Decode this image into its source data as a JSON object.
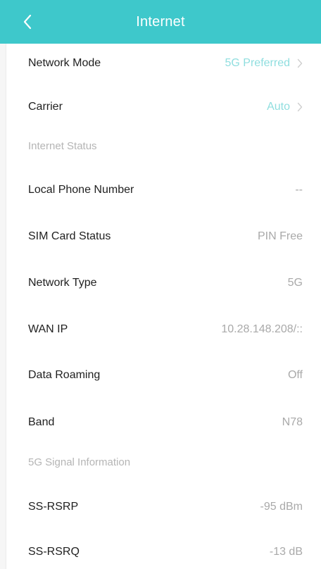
{
  "header": {
    "title": "Internet",
    "back_icon": "chevron-left-icon"
  },
  "settings": [
    {
      "label": "Network Mode",
      "value": "5G Preferred"
    },
    {
      "label": "Carrier",
      "value": "Auto"
    }
  ],
  "sections": {
    "internet_status": "Internet Status",
    "signal_info": "5G Signal Information"
  },
  "status": [
    {
      "label": "Local Phone Number",
      "value": "--"
    },
    {
      "label": "SIM Card Status",
      "value": "PIN Free"
    },
    {
      "label": "Network Type",
      "value": "5G"
    },
    {
      "label": "WAN IP",
      "value": "10.28.148.208/::"
    },
    {
      "label": "Data Roaming",
      "value": "Off"
    },
    {
      "label": "Band",
      "value": "N78"
    }
  ],
  "signal": [
    {
      "label": "SS-RSRP",
      "value": "-95 dBm"
    },
    {
      "label": "SS-RSRQ",
      "value": "-13 dB"
    }
  ],
  "colors": {
    "header": "#3ec8cb",
    "link_value": "#8fdedf",
    "muted": "#a9a9a9"
  }
}
